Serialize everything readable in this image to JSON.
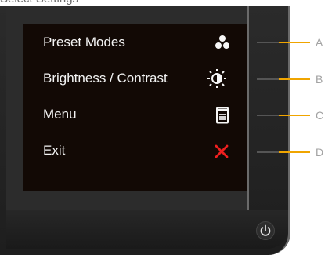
{
  "top_text": "Select Settings",
  "menu": {
    "items": [
      {
        "label": "Preset Modes",
        "icon": "preset-dots-icon"
      },
      {
        "label": "Brightness / Contrast",
        "icon": "brightness-contrast-icon"
      },
      {
        "label": "Menu",
        "icon": "menu-document-icon"
      },
      {
        "label": "Exit",
        "icon": "exit-x-icon"
      }
    ]
  },
  "callouts": [
    {
      "label": "A"
    },
    {
      "label": "B"
    },
    {
      "label": "C"
    },
    {
      "label": "D"
    }
  ],
  "colors": {
    "screen_background": "#120905",
    "menu_text": "#f4f4f4",
    "exit_red": "#ef1f1f",
    "callout_orange": "#f0a500",
    "callout_text": "#a2a2a2"
  }
}
